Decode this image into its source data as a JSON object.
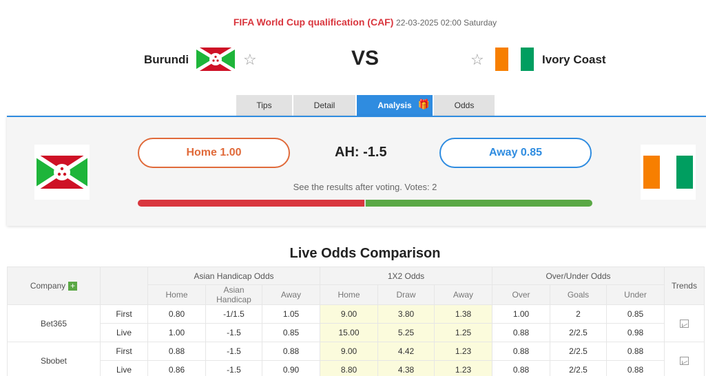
{
  "match": {
    "league": "FIFA World Cup qualification (CAF)",
    "datetime": "22-03-2025 02:00 Saturday",
    "home": "Burundi",
    "away": "Ivory Coast",
    "vs": "VS"
  },
  "tabs": [
    {
      "label": "Tips"
    },
    {
      "label": "Detail"
    },
    {
      "label": "Analysis"
    },
    {
      "label": "Odds"
    }
  ],
  "vote": {
    "home_label": "Home 1.00",
    "away_label": "Away 0.85",
    "ah": "AH: -1.5",
    "note": "See the results after voting. Votes: 2",
    "home_share": 0.5,
    "away_share": 0.5
  },
  "odds": {
    "title": "Live Odds Comparison",
    "headers": {
      "company": "Company",
      "plus": "+",
      "ah_group": "Asian Handicap Odds",
      "x12_group": "1X2 Odds",
      "ou_group": "Over/Under Odds",
      "trends": "Trends",
      "ah_cols": [
        "Home",
        "Asian Handicap",
        "Away"
      ],
      "x12_cols": [
        "Home",
        "Draw",
        "Away"
      ],
      "ou_cols": [
        "Over",
        "Goals",
        "Under"
      ]
    },
    "rows": [
      {
        "company": "Bet365",
        "lines": [
          {
            "type": "First",
            "ah": [
              "0.80",
              "-1/1.5",
              "1.05"
            ],
            "x12": [
              "9.00",
              "3.80",
              "1.38"
            ],
            "ou": [
              "1.00",
              "2",
              "0.85"
            ]
          },
          {
            "type": "Live",
            "ah": [
              "1.00",
              "-1.5",
              "0.85"
            ],
            "x12": [
              "15.00",
              "5.25",
              "1.25"
            ],
            "ou": [
              "0.88",
              "2/2.5",
              "0.98"
            ]
          }
        ]
      },
      {
        "company": "Sbobet",
        "lines": [
          {
            "type": "First",
            "ah": [
              "0.88",
              "-1.5",
              "0.88"
            ],
            "x12": [
              "9.00",
              "4.42",
              "1.23"
            ],
            "ou": [
              "0.88",
              "2/2.5",
              "0.88"
            ]
          },
          {
            "type": "Live",
            "ah": [
              "0.86",
              "-1.5",
              "0.90"
            ],
            "x12": [
              "8.80",
              "4.38",
              "1.23"
            ],
            "ou": [
              "0.88",
              "2/2.5",
              "0.88"
            ]
          }
        ]
      }
    ]
  },
  "icons": {
    "star": "star-outline-icon",
    "gift": "gift-icon",
    "trend": "trend-chart-icon"
  },
  "colors": {
    "league": "#d9363e",
    "accent": "#2f8ce0",
    "home_vote": "#e06a3a",
    "bar_home": "#d9363e",
    "bar_away": "#5aa845",
    "x12_bg": "#fbfbdc"
  }
}
